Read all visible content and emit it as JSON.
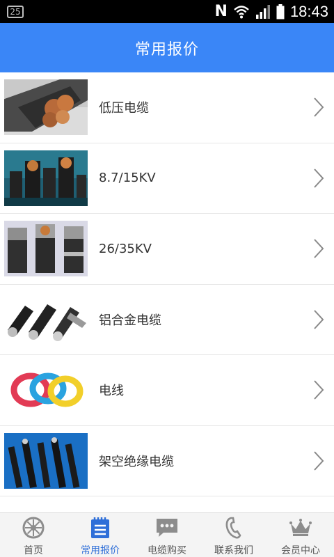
{
  "status_bar": {
    "notification_count": "25",
    "network_letter": "N",
    "time": "18:43"
  },
  "header": {
    "title": "常用报价"
  },
  "list": {
    "items": [
      {
        "label": "低压电缆",
        "thumb_icon": "low-voltage-cable-photo"
      },
      {
        "label": "8.7/15KV",
        "thumb_icon": "medium-voltage-cable-photo"
      },
      {
        "label": "26/35KV",
        "thumb_icon": "high-voltage-cable-photo"
      },
      {
        "label": "铝合金电缆",
        "thumb_icon": "aluminum-alloy-cable-photo"
      },
      {
        "label": "电线",
        "thumb_icon": "electric-wire-coils-photo"
      },
      {
        "label": "架空绝缘电缆",
        "thumb_icon": "overhead-insulated-cable-photo"
      }
    ]
  },
  "tab_bar": {
    "tabs": [
      {
        "label": "首页",
        "icon": "home-wheel-icon",
        "active": false
      },
      {
        "label": "常用报价",
        "icon": "list-document-icon",
        "active": true
      },
      {
        "label": "电缆购买",
        "icon": "chat-bubble-icon",
        "active": false
      },
      {
        "label": "联系我们",
        "icon": "phone-icon",
        "active": false
      },
      {
        "label": "会员中心",
        "icon": "crown-icon",
        "active": false
      }
    ]
  },
  "colors": {
    "header_bg": "#3a86f7",
    "active_tab": "#2f6fd8",
    "inactive_tab_icon": "#8c8c8c"
  }
}
